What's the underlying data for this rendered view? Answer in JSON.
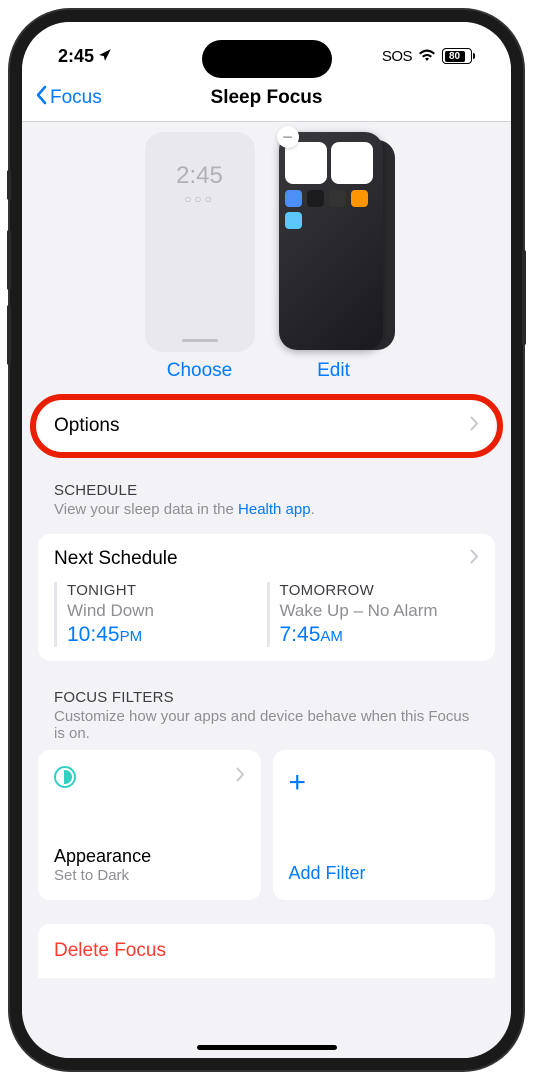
{
  "status": {
    "time": "2:45",
    "sos": "SOS",
    "battery": "80"
  },
  "nav": {
    "back": "Focus",
    "title": "Sleep Focus"
  },
  "previews": {
    "lock_time": "2:45",
    "lock_dots": "○○○",
    "choose": "Choose",
    "edit": "Edit",
    "remove": "−"
  },
  "options": {
    "label": "Options"
  },
  "schedule_section": {
    "header": "SCHEDULE",
    "sub_prefix": "View your sleep data in the ",
    "sub_link": "Health app",
    "sub_suffix": "."
  },
  "schedule": {
    "title": "Next Schedule",
    "tonight": {
      "label": "TONIGHT",
      "desc": "Wind Down",
      "time": "10:45",
      "ampm": "PM"
    },
    "tomorrow": {
      "label": "TOMORROW",
      "desc": "Wake Up – No Alarm",
      "time": "7:45",
      "ampm": "AM"
    }
  },
  "filters_section": {
    "header": "FOCUS FILTERS",
    "sub": "Customize how your apps and device behave when this Focus is on."
  },
  "filters": {
    "appearance": {
      "title": "Appearance",
      "sub": "Set to Dark"
    },
    "add": {
      "plus": "+",
      "label": "Add Filter"
    }
  },
  "delete": {
    "label": "Delete Focus"
  }
}
